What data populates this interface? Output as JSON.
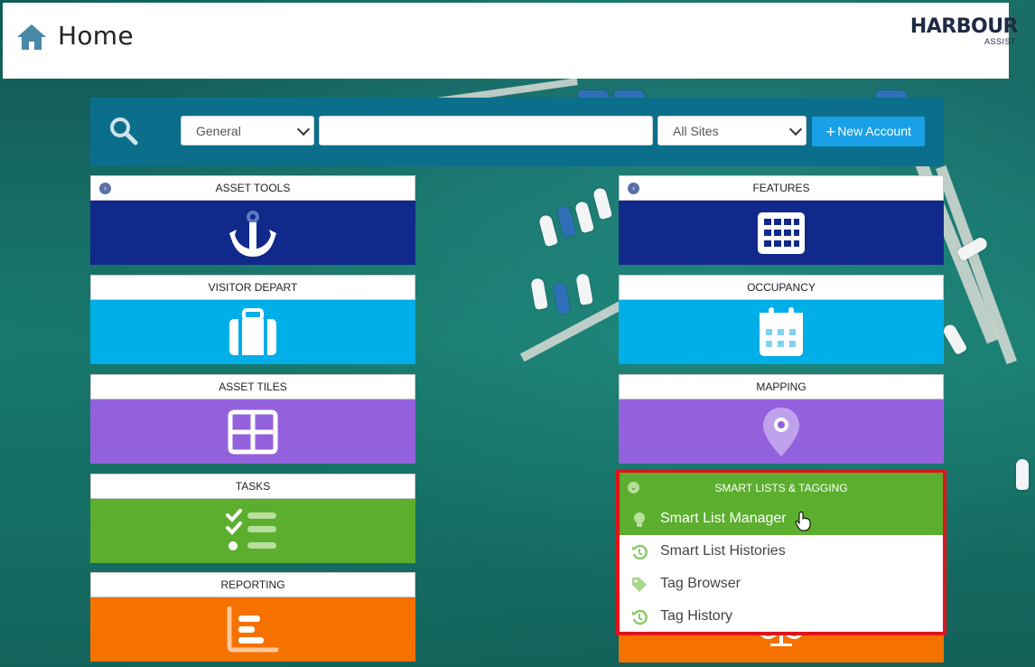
{
  "header": {
    "title": "Home",
    "logo_main": "HARBOUR",
    "logo_sub": "ASSIST"
  },
  "search": {
    "type_select": "General",
    "site_select": "All Sites",
    "query_value": "",
    "new_account_label": "New Account"
  },
  "tiles": {
    "asset_tools": "ASSET TOOLS",
    "features": "FEATURES",
    "visitor_depart": "VISITOR DEPART",
    "occupancy": "OCCUPANCY",
    "asset_tiles": "ASSET TILES",
    "mapping": "MAPPING",
    "tasks": "TASKS",
    "reporting": "REPORTING"
  },
  "smart_lists": {
    "title": "SMART LISTS & TAGGING",
    "items": [
      {
        "label": "Smart List Manager",
        "icon": "lightbulb-icon",
        "active": true
      },
      {
        "label": "Smart List Histories",
        "icon": "history-icon",
        "active": false
      },
      {
        "label": "Tag Browser",
        "icon": "tag-icon",
        "active": false
      },
      {
        "label": "Tag History",
        "icon": "history-icon",
        "active": false
      }
    ]
  },
  "colors": {
    "navy": "#10298a",
    "cyan": "#00aee8",
    "purple": "#9461dc",
    "green": "#5cae2e",
    "orange": "#f57100",
    "searchbar": "#0b6f8c",
    "highlight_border": "#e0141c"
  }
}
